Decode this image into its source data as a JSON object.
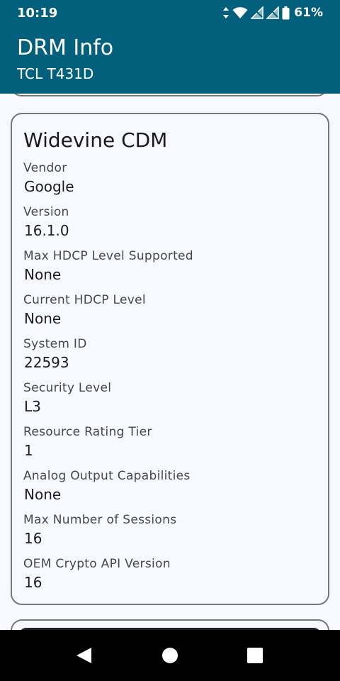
{
  "status_bar": {
    "time": "10:19",
    "battery_percent": "61%",
    "icons": [
      "data-arrows-icon",
      "wifi-icon",
      "signal-off-icon",
      "signal-off-icon",
      "battery-icon"
    ]
  },
  "app_bar": {
    "title": "DRM Info",
    "subtitle": "TCL T431D",
    "color": "#03607d"
  },
  "card": {
    "title": "Widevine CDM",
    "fields": [
      {
        "label": "Vendor",
        "value": "Google"
      },
      {
        "label": "Version",
        "value": "16.1.0"
      },
      {
        "label": "Max HDCP Level Supported",
        "value": "None"
      },
      {
        "label": "Current HDCP Level",
        "value": "None"
      },
      {
        "label": "System ID",
        "value": "22593"
      },
      {
        "label": "Security Level",
        "value": "L3"
      },
      {
        "label": "Resource Rating Tier",
        "value": "1"
      },
      {
        "label": "Analog Output Capabilities",
        "value": "None"
      },
      {
        "label": "Max Number of Sessions",
        "value": "16"
      },
      {
        "label": "OEM Crypto API Version",
        "value": "16"
      }
    ]
  },
  "nav_bar": {
    "buttons": [
      "back-icon",
      "home-icon",
      "recents-icon"
    ]
  }
}
